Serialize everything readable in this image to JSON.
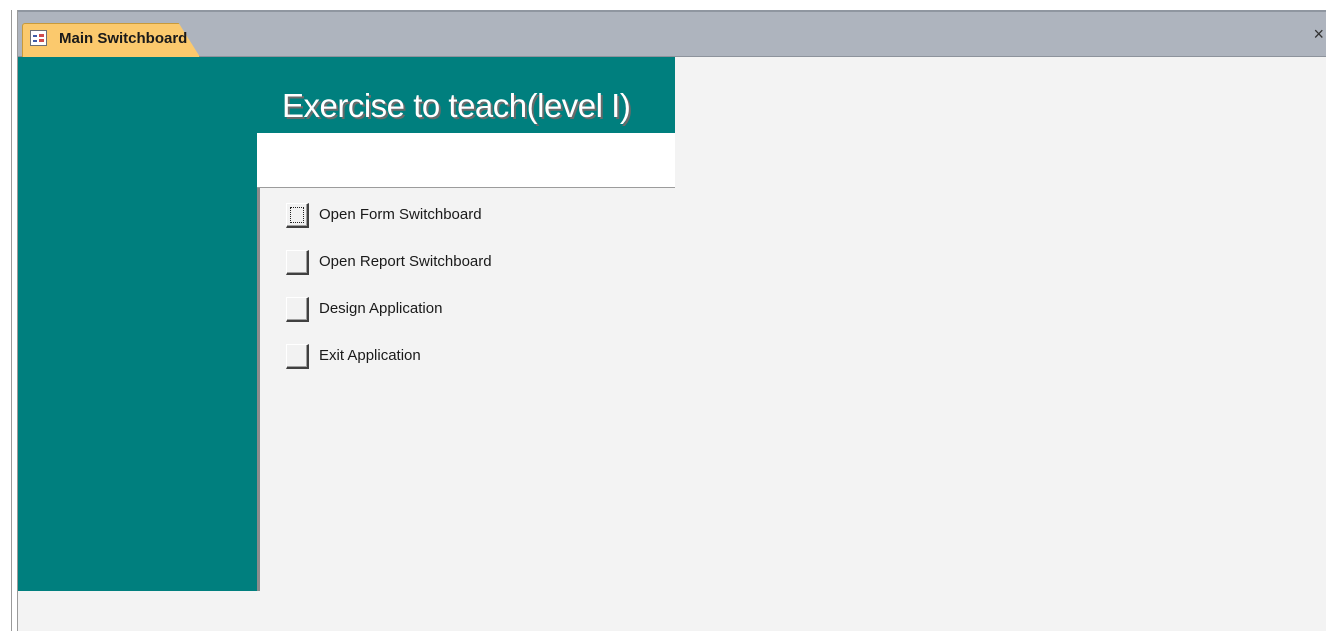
{
  "tab": {
    "title": "Main Switchboard",
    "icon": "form-icon",
    "close_label": "×"
  },
  "form": {
    "title": "Exercise to teach(level I)",
    "accent_color": "#007f7e",
    "items": [
      {
        "label": "Open Form Switchboard"
      },
      {
        "label": "Open Report Switchboard"
      },
      {
        "label": "Design Application"
      },
      {
        "label": "Exit Application"
      }
    ]
  }
}
